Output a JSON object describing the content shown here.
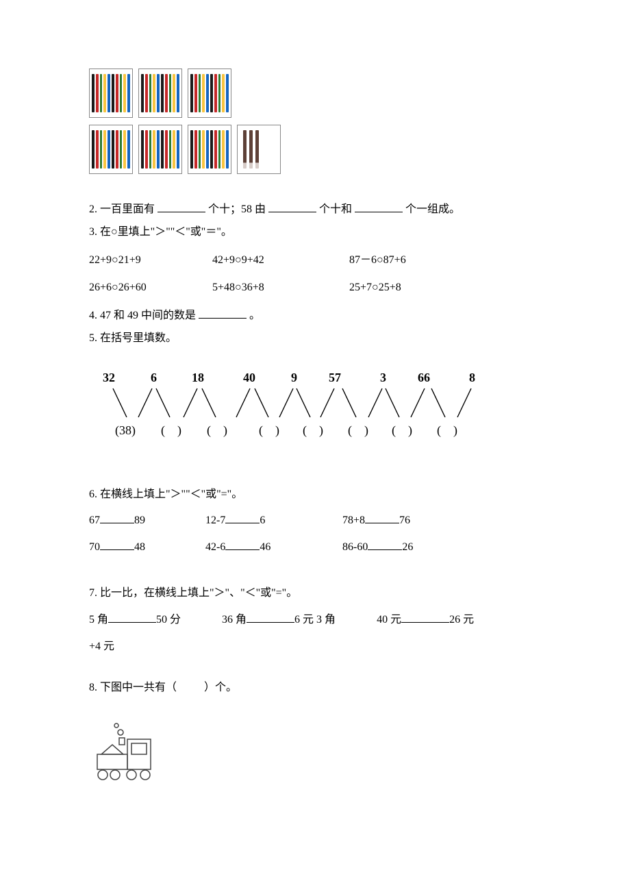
{
  "q2": {
    "text_a": "2. 一百里面有",
    "text_b": "个十；58 由",
    "text_c": "个十和",
    "text_d": "个一组成。"
  },
  "q3": {
    "title": "3. 在○里填上\"＞\"\"＜\"或\"＝\"。",
    "row1": {
      "a": "22+9○21+9",
      "b": "42+9○9+42",
      "c": "87－6○87+6"
    },
    "row2": {
      "a": "26+6○26+60",
      "b": "5+48○36+8",
      "c": "25+7○25+8"
    }
  },
  "q4": {
    "text_a": "4. 47 和 49 中间的数是",
    "text_b": "。"
  },
  "q5": {
    "title": "5. 在括号里填数。",
    "nums": [
      "32",
      "6",
      "18",
      "40",
      "9",
      "57",
      "3",
      "66",
      "8"
    ],
    "first_paren": "(38)"
  },
  "q6": {
    "title": "6. 在横线上填上\"＞\"\"＜\"或\"=\"。",
    "row1": {
      "a1": "67",
      "a2": "89",
      "b1": "12-7",
      "b2": "6",
      "c1": "78+8",
      "c2": "76"
    },
    "row2": {
      "a1": "70",
      "a2": "48",
      "b1": "42-6",
      "b2": "46",
      "c1": "86-60",
      "c2": "26"
    }
  },
  "q7": {
    "title": "7. 比一比，在横线上填上\"＞\"、\"＜\"或\"=\"。",
    "a1": "5 角",
    "a2": "50 分",
    "b1": "36 角",
    "b2": "6 元 3 角",
    "c1": "40 元",
    "c2": "26 元",
    "c3": "+4 元"
  },
  "q8": {
    "text_a": "8. 下图中一共有（",
    "text_b": "）个。"
  }
}
